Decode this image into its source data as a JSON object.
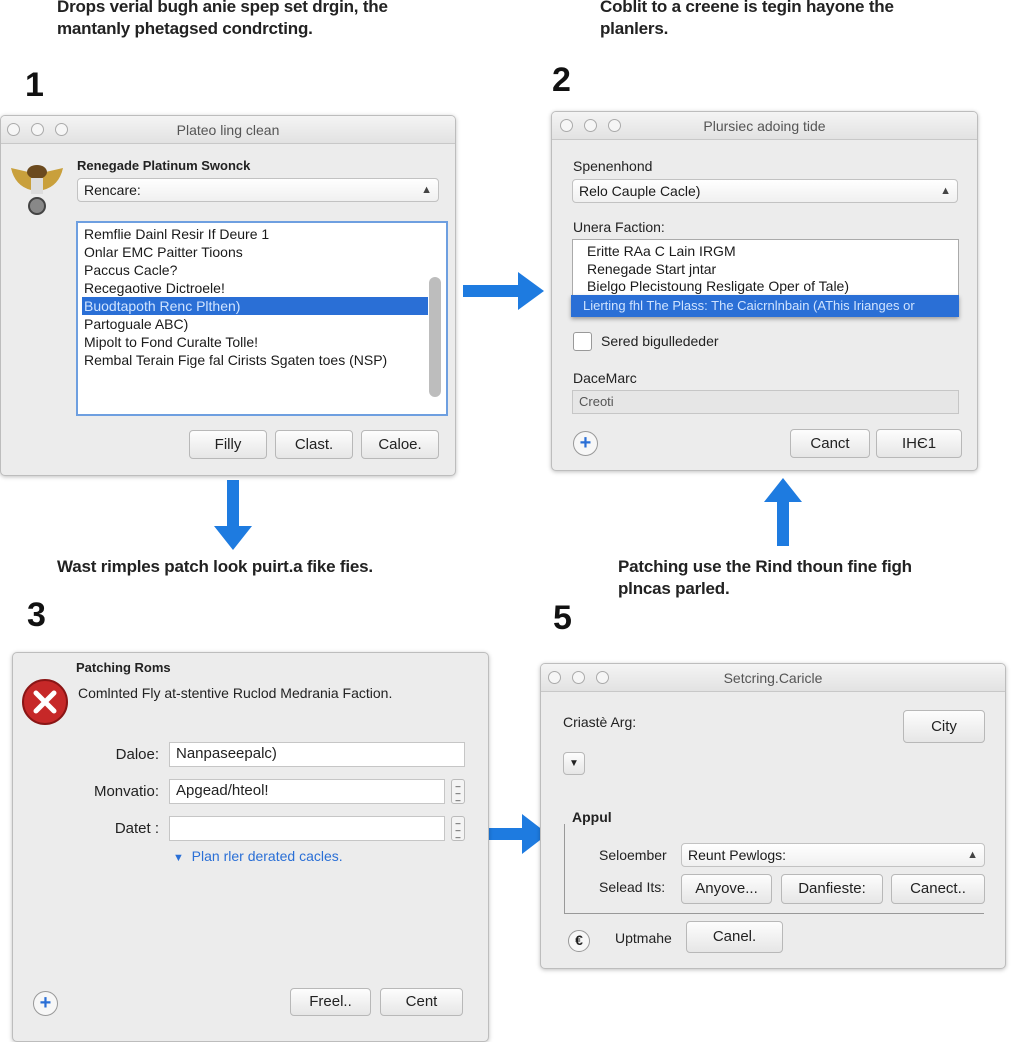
{
  "colors": {
    "accent": "#1e7be0",
    "selection": "#2a6fd6",
    "error": "#c62828"
  },
  "captions": {
    "top_left": [
      "Drops verial bugh anie spep set drgin, the",
      "mantanly phetagsed condrcting."
    ],
    "top_right": [
      "Coblit to a creene is tegin hayone the",
      "planlers."
    ],
    "mid_left": [
      "Wast rimples patch look puirt.a fike fies."
    ],
    "mid_right": [
      "Patching use the Rind thoun fine figh",
      "plncas parled."
    ]
  },
  "steps": [
    "1",
    "2",
    "3",
    "5"
  ],
  "dialog1": {
    "title": "Plateo ling clean",
    "icon": "winged-emblem-icon",
    "heading": "Renegade Platinum Swonck",
    "select_value": "Rencare:",
    "list": [
      "Remflie Dainl Resir If Deure 1",
      "Onlar EMC Paitter Tioons",
      "Paccus Cacle?",
      "Recegaotive Dictroele!",
      "Buodtapoth Renc Plthen)",
      "Partoguale ABC)",
      "Mipolt to Fond Curalte Tolle!",
      "Rembal Terain Fige fal Cirists Sgaten toes (NSP)"
    ],
    "selected_index": 4,
    "buttons": [
      "Filly",
      "Clast.",
      "Caloe."
    ]
  },
  "dialog2": {
    "title": "Plursiec adoing tide",
    "label1": "Spenenhond",
    "select_value": "Relo Cauple Cacle)",
    "label2": "Unera Faction:",
    "list": [
      "Eritte RAa C Lain IRGM",
      "Renegade Start jntar",
      "Bielgo Plecistoung Resligate Oper of Tale)"
    ],
    "highlighted": "Lierting fhl The Plass: The Caicrnlnbain (AThis Irianges or",
    "checkbox_label": "Sered bigullededer",
    "checkbox_checked": false,
    "label3": "DaceMarc",
    "input_value": "Creoti",
    "buttons": [
      "Canct",
      "IHЄ1"
    ]
  },
  "dialog3": {
    "heading": "Patching Roms",
    "icon": "error-icon",
    "message": "Comlnted Fly at-stentive Ruclod Medrania Faction.",
    "fields": [
      {
        "label": "Daloe:",
        "value": "Nanpaseepalc)"
      },
      {
        "label": "Monvatio:",
        "value": "Apgead/hteol!"
      },
      {
        "label": "Datet :",
        "value": ""
      }
    ],
    "link": "Plan rler derated cacles.",
    "buttons": [
      "Freel..",
      "Cent"
    ]
  },
  "dialog5": {
    "title": "Setcring.Caricle",
    "label1": "Criastè Arg:",
    "city_button": "City",
    "group_label": "Appul",
    "select_label": "Seloember",
    "select_value": "Reunt Pewlogs:",
    "buttons_label": "Selead Its:",
    "buttons": [
      "Anyove...",
      "Danfieste:",
      "Canect.."
    ],
    "bottom_label": "Uptmahe",
    "bottom_button": "Canel."
  }
}
